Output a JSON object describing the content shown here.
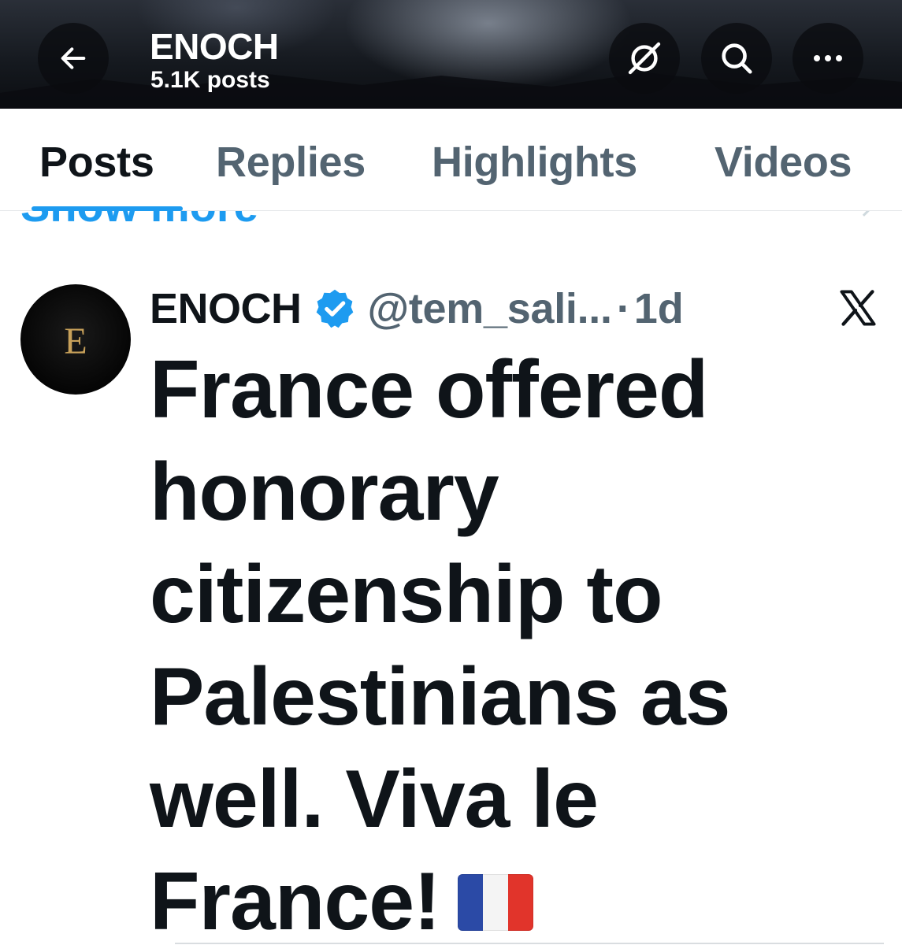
{
  "header": {
    "title": "ENOCH",
    "post_count": "5.1K posts",
    "icons": [
      "back-arrow-icon",
      "grok-icon",
      "search-icon",
      "more-icon"
    ]
  },
  "tabs": [
    {
      "label": "Posts",
      "active": true
    },
    {
      "label": "Replies",
      "active": false
    },
    {
      "label": "Highlights",
      "active": false
    },
    {
      "label": "Videos",
      "active": false
    }
  ],
  "show_more": "Show more",
  "tweet": {
    "avatar_letter": "E",
    "author": "ENOCH",
    "verified": true,
    "handle": "@tem_sali...",
    "separator": "·",
    "time": "1d",
    "lines": [
      "France offered",
      "honorary",
      "citizenship to",
      "Palestinians as",
      "well. Viva le",
      "France!"
    ],
    "flag": "french-flag"
  },
  "colors": {
    "accent": "#1d9bf0",
    "text": "#0f1419",
    "muted": "#536471",
    "avatar_letter": "#c8a15a"
  }
}
